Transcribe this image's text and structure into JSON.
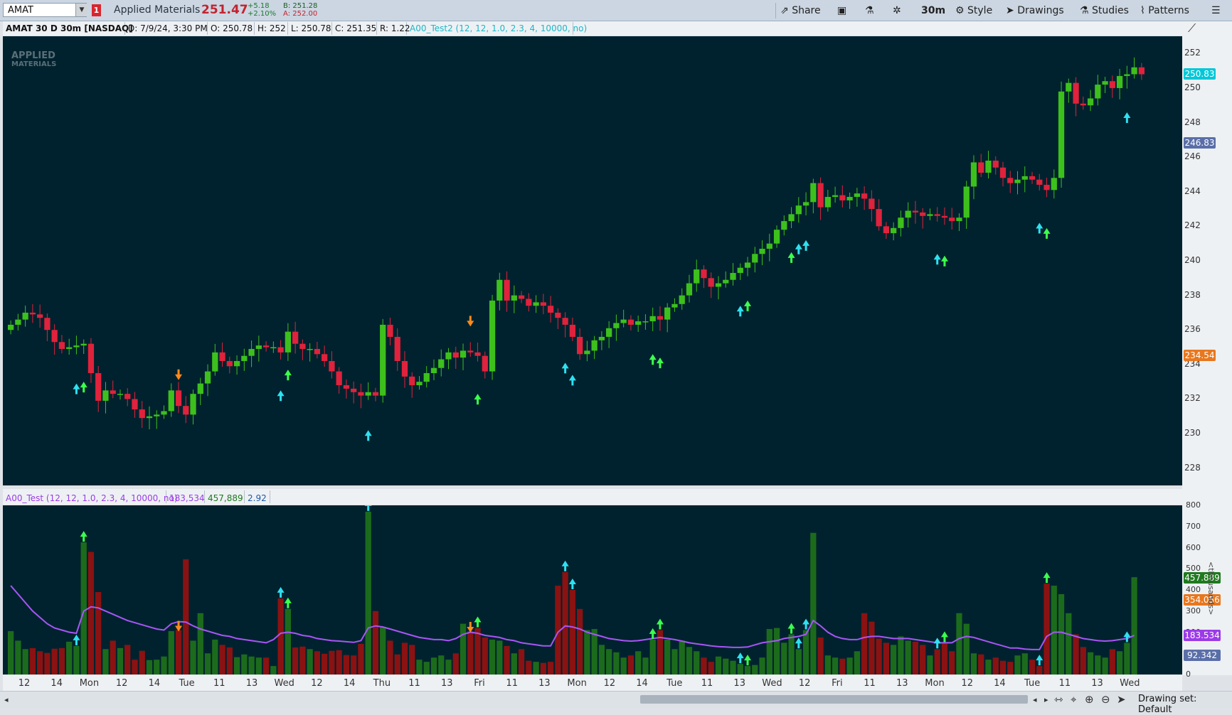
{
  "toolbar": {
    "symbol": "AMAT",
    "link_number": "1",
    "company": "Applied Materials",
    "last_price": "251.47",
    "change": "+5.18",
    "change_pct": "+2.10%",
    "bid": "B: 251.28",
    "ask": "A: 252.00",
    "share_label": "Share",
    "timeframe": "30m",
    "style_label": "Style",
    "drawings_label": "Drawings",
    "studies_label": "Studies",
    "patterns_label": "Patterns"
  },
  "info_bar": {
    "title": "AMAT 30 D 30m [NASDAQ]",
    "date": "D: 7/9/24, 3:30 PM",
    "open": "O: 250.78",
    "high": "H: 252",
    "low": "L: 250.78",
    "close": "C: 251.35",
    "range": "R: 1.22",
    "study": "A00_Test2 (12, 12, 1.0, 2.3, 4, 10000, no)"
  },
  "watermark": {
    "line1": "APPLIED",
    "line2": "MATERIALS"
  },
  "price_axis": {
    "ticks": [
      "252",
      "250",
      "248",
      "246",
      "244",
      "242",
      "240",
      "238",
      "236",
      "234",
      "232",
      "230",
      "228"
    ],
    "tags": [
      {
        "label": "250.83",
        "color": "#00c8d8",
        "price": 250.83
      },
      {
        "label": "246.83",
        "color": "#5a6fa8",
        "price": 246.83
      },
      {
        "label": "234.54",
        "color": "#e8771e",
        "price": 234.54
      }
    ]
  },
  "lower_panel": {
    "title": "A00_Test (12, 12, 1.0, 2.3, 4, 10000, no)",
    "value1": "183,534",
    "value2": "457,889",
    "value3": "2.92",
    "ticks": [
      "800",
      "700",
      "600",
      "500",
      "400",
      "300",
      "200",
      "100",
      "0"
    ],
    "unit_label": "<thousands>",
    "tags": [
      {
        "label": "457.889",
        "color": "#1f7a1f",
        "value": 457.889
      },
      {
        "label": "354.056",
        "color": "#e8771e",
        "value": 354.056
      },
      {
        "label": "183.534",
        "color": "#9b3be8",
        "value": 183.534
      },
      {
        "label": "92.342",
        "color": "#5a6fa8",
        "value": 92.342
      }
    ]
  },
  "time_axis": {
    "labels": [
      "12",
      "14",
      "Mon",
      "12",
      "14",
      "Tue",
      "11",
      "13",
      "Wed",
      "12",
      "14",
      "Thu",
      "11",
      "13",
      "Fri",
      "11",
      "13",
      "Mon",
      "12",
      "14",
      "Tue",
      "11",
      "13",
      "Wed",
      "12",
      "Fri",
      "11",
      "13",
      "Mon",
      "12",
      "14",
      "Tue",
      "11",
      "13",
      "Wed"
    ]
  },
  "status": {
    "drawing_set": "Drawing set: Default"
  },
  "chart_data": {
    "type": "candlestick",
    "symbol": "AMAT",
    "interval": "30m",
    "ylim": [
      227,
      253
    ],
    "closes": [
      236.3,
      236.6,
      237.0,
      236.9,
      236.7,
      236.0,
      235.3,
      234.9,
      235.0,
      235.1,
      235.2,
      233.5,
      231.9,
      232.5,
      232.3,
      232.3,
      232.0,
      231.4,
      230.9,
      231.0,
      231.1,
      231.3,
      232.5,
      231.6,
      231.1,
      232.3,
      232.9,
      233.6,
      234.7,
      234.2,
      233.9,
      234.2,
      234.5,
      234.9,
      235.1,
      235.0,
      235.0,
      234.7,
      235.9,
      235.2,
      234.9,
      234.9,
      234.6,
      234.2,
      233.6,
      232.8,
      232.6,
      232.4,
      232.2,
      232.4,
      232.2,
      236.3,
      235.6,
      234.2,
      233.3,
      232.8,
      233.0,
      233.5,
      233.8,
      234.3,
      234.7,
      234.4,
      234.8,
      234.7,
      234.5,
      233.6,
      237.7,
      238.9,
      237.7,
      238.0,
      237.8,
      237.4,
      237.6,
      237.4,
      237.0,
      236.7,
      236.3,
      235.6,
      234.6,
      234.8,
      235.4,
      235.6,
      236.1,
      236.4,
      236.6,
      236.3,
      236.5,
      236.5,
      236.8,
      236.6,
      237.3,
      237.5,
      238.0,
      238.7,
      239.5,
      239.0,
      238.5,
      238.7,
      238.9,
      239.3,
      239.6,
      239.9,
      240.4,
      240.7,
      241.0,
      241.8,
      242.3,
      242.7,
      243.2,
      243.4,
      244.5,
      243.1,
      243.7,
      243.8,
      243.5,
      243.7,
      243.9,
      243.6,
      243.0,
      242.0,
      241.6,
      241.9,
      242.5,
      242.9,
      242.8,
      242.6,
      242.7,
      242.6,
      242.5,
      242.3,
      242.5,
      244.3,
      245.7,
      245.1,
      245.8,
      245.4,
      244.8,
      244.5,
      244.7,
      244.9,
      244.7,
      244.4,
      244.1,
      244.8,
      249.8,
      250.3,
      249.1,
      249.0,
      249.4,
      250.2,
      250.4,
      250.0,
      250.7,
      250.8,
      251.2,
      250.8
    ],
    "volume_k": [
      205,
      160,
      120,
      125,
      110,
      102,
      122,
      125,
      155,
      135,
      625,
      580,
      390,
      120,
      160,
      125,
      140,
      70,
      112,
      68,
      70,
      85,
      205,
      210,
      545,
      160,
      290,
      100,
      165,
      140,
      128,
      82,
      95,
      85,
      80,
      80,
      40,
      360,
      310,
      128,
      132,
      120,
      110,
      98,
      112,
      115,
      92,
      90,
      145,
      770,
      300,
      225,
      160,
      95,
      150,
      140,
      70,
      60,
      80,
      90,
      70,
      100,
      240,
      205,
      220,
      175,
      165,
      160,
      135,
      100,
      120,
      65,
      60,
      55,
      60,
      420,
      485,
      400,
      310,
      210,
      215,
      140,
      120,
      105,
      80,
      90,
      110,
      80,
      165,
      210,
      165,
      120,
      160,
      130,
      110,
      80,
      60,
      85,
      75,
      65,
      50,
      40,
      45,
      80,
      215,
      220,
      150,
      190,
      120,
      210,
      670,
      175,
      90,
      80,
      75,
      80,
      110,
      290,
      250,
      170,
      150,
      140,
      180,
      160,
      155,
      140,
      90,
      120,
      150,
      110,
      290,
      240,
      100,
      95,
      70,
      80,
      65,
      60,
      90,
      100,
      70,
      40,
      430,
      420,
      380,
      290,
      190,
      130,
      105,
      90,
      80,
      120,
      110,
      150,
      460
    ],
    "ma_k": [
      420,
      380,
      340,
      300,
      270,
      240,
      220,
      210,
      200,
      195,
      300,
      320,
      315,
      300,
      285,
      270,
      255,
      245,
      235,
      225,
      215,
      210,
      240,
      250,
      248,
      230,
      215,
      205,
      195,
      185,
      180,
      170,
      165,
      160,
      155,
      150,
      165,
      195,
      200,
      195,
      185,
      180,
      170,
      165,
      160,
      158,
      155,
      152,
      160,
      220,
      230,
      225,
      215,
      205,
      195,
      185,
      175,
      170,
      165,
      165,
      160,
      170,
      190,
      200,
      195,
      185,
      180,
      175,
      165,
      160,
      150,
      145,
      140,
      135,
      135,
      200,
      230,
      225,
      215,
      200,
      190,
      180,
      170,
      165,
      160,
      158,
      160,
      165,
      170,
      175,
      170,
      165,
      158,
      150,
      145,
      140,
      135,
      132,
      130,
      128,
      128,
      130,
      140,
      150,
      155,
      160,
      170,
      175,
      180,
      190,
      255,
      230,
      200,
      180,
      170,
      165,
      165,
      175,
      180,
      180,
      175,
      170,
      170,
      170,
      165,
      160,
      155,
      150,
      150,
      150,
      170,
      180,
      175,
      165,
      155,
      145,
      135,
      125,
      125,
      120,
      118,
      118,
      180,
      200,
      200,
      190,
      180,
      170,
      165,
      160,
      158,
      160,
      165,
      170,
      185
    ],
    "markers": [
      {
        "type": "cyan-up",
        "index": 9,
        "panel": "price"
      },
      {
        "type": "green-up",
        "index": 10,
        "panel": "price"
      },
      {
        "type": "orange-down",
        "index": 23,
        "panel": "price"
      },
      {
        "type": "cyan-up",
        "index": 37,
        "panel": "price"
      },
      {
        "type": "green-up",
        "index": 38,
        "panel": "price"
      },
      {
        "type": "cyan-up",
        "index": 49,
        "panel": "price"
      },
      {
        "type": "orange-down",
        "index": 63,
        "panel": "price"
      },
      {
        "type": "green-up",
        "index": 64,
        "panel": "price"
      },
      {
        "type": "cyan-up",
        "index": 76,
        "panel": "price"
      },
      {
        "type": "cyan-up",
        "index": 77,
        "panel": "price"
      },
      {
        "type": "green-up",
        "index": 88,
        "panel": "price"
      },
      {
        "type": "green-up",
        "index": 89,
        "panel": "price"
      },
      {
        "type": "cyan-up",
        "index": 100,
        "panel": "price"
      },
      {
        "type": "green-up",
        "index": 101,
        "panel": "price"
      },
      {
        "type": "green-up",
        "index": 107,
        "panel": "price"
      },
      {
        "type": "cyan-up",
        "index": 108,
        "panel": "price"
      },
      {
        "type": "cyan-up",
        "index": 109,
        "panel": "price"
      },
      {
        "type": "cyan-up",
        "index": 127,
        "panel": "price"
      },
      {
        "type": "green-up",
        "index": 128,
        "panel": "price"
      },
      {
        "type": "cyan-up",
        "index": 141,
        "panel": "price"
      },
      {
        "type": "green-up",
        "index": 142,
        "panel": "price"
      },
      {
        "type": "cyan-up",
        "index": 153,
        "panel": "price"
      }
    ]
  }
}
